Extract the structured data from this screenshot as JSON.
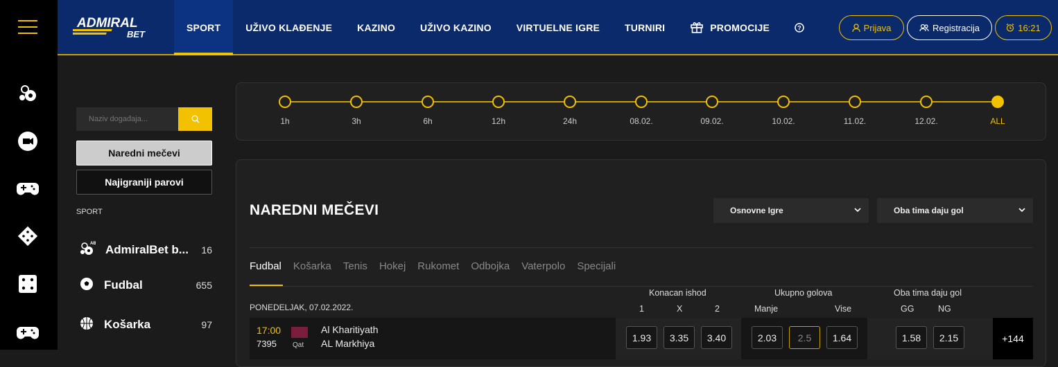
{
  "header": {
    "logo_text": "ADMIRAL",
    "logo_sub": "BET",
    "nav": [
      "SPORT",
      "UŽIVO KLAĐENJE",
      "KAZINO",
      "UŽIVO KAZINO",
      "VIRTUELNE IGRE",
      "TURNIRI",
      "PROMOCIJE"
    ],
    "help_icon": "question-circle-icon",
    "login_label": "Prijava",
    "register_label": "Registracija",
    "clock_label": "16:21",
    "accent_color": "#f2c200",
    "bar_color": "#0a2a6b"
  },
  "left_rail": {
    "icons": [
      "hamburger-icon",
      "sports-balls-icon",
      "live-camera-icon",
      "gamepad-icon",
      "diamond-dice-icon",
      "dice-icon",
      "gamepad-icon"
    ]
  },
  "sidebar": {
    "search_placeholder": "Naziv događaja...",
    "btn_upcoming": "Naredni mečevi",
    "btn_most_played": "Najigraniji parovi",
    "section_label": "SPORT",
    "sports": [
      {
        "name": "AdmiralBet b...",
        "count": "16",
        "icon": "admiralbet-balls-icon"
      },
      {
        "name": "Fudbal",
        "count": "655",
        "icon": "soccer-ball-icon"
      },
      {
        "name": "Košarka",
        "count": "97",
        "icon": "basketball-icon"
      }
    ]
  },
  "timeline": {
    "labels": [
      "1h",
      "3h",
      "6h",
      "12h",
      "24h",
      "08.02.",
      "09.02.",
      "10.02.",
      "11.02.",
      "12.02.",
      "ALL"
    ],
    "selected": "ALL"
  },
  "main": {
    "title": "NAREDNI MEČEVI",
    "select1": "Osnovne Igre",
    "select2": "Oba tima daju gol",
    "tabs": [
      "Fudbal",
      "Košarka",
      "Tenis",
      "Hokej",
      "Rukomet",
      "Odbojka",
      "Vaterpolo",
      "Specijali"
    ],
    "active_tab": "Fudbal",
    "group_headers": [
      "Konacan ishod",
      "Ukupno golova",
      "Oba tima daju gol"
    ],
    "sub_headers": [
      "1",
      "X",
      "2",
      "Manje",
      "Vise",
      "GG",
      "NG"
    ],
    "date": "PONEDELJAK, 07.02.2022.",
    "match": {
      "time": "17:00",
      "code": "7395",
      "country": "Qat",
      "home": "Al Kharitiyath",
      "away": "AL Markhiya",
      "odds": [
        "1.93",
        "3.35",
        "3.40",
        "2.03",
        "2.5",
        "1.64",
        "1.58",
        "2.15"
      ],
      "more": "+144"
    }
  }
}
